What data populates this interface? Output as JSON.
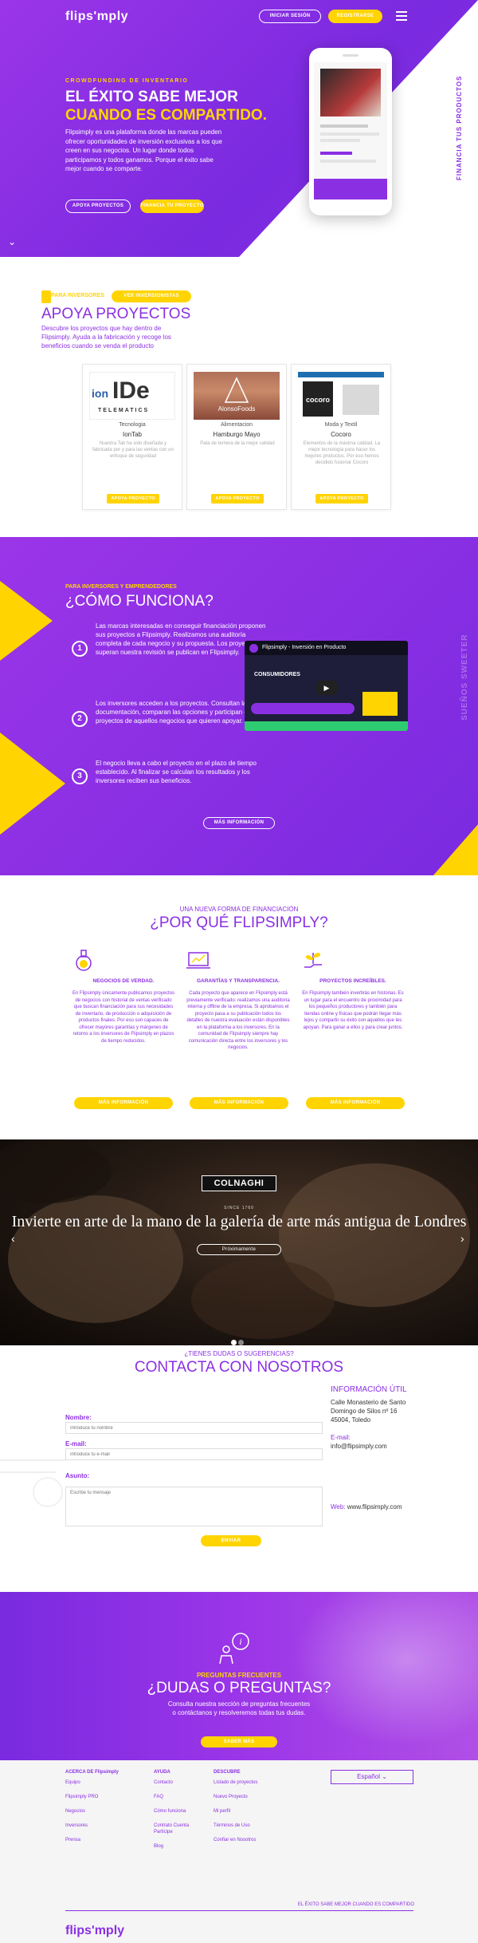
{
  "header": {
    "logo": "flipsʹmply",
    "login": "INICIAR SESIÓN",
    "register": "REGISTRARSE"
  },
  "hero": {
    "tag": "CROWDFUNDING DE INVENTARIO",
    "title1": "EL ÉXITO SABE MEJOR",
    "title2": "CUANDO ES COMPARTIDO.",
    "text": "Flipsimply es una plataforma donde las marcas pueden ofrecer oportunidades de inversión exclusivas a los que creen en sus negocios. Un lugar donde todos participamos y todos ganamos. Porque el éxito sabe mejor cuando se comparte.",
    "btn_apoya": "APOYA PROYECTOS",
    "btn_financia": "FINANCIA TU PROYECTO",
    "vertical": "FINANCIA TUS PRODUCTOS"
  },
  "apoya": {
    "tag": "PARA INVERSORES",
    "tag_btn": "VER INVERSIONISTAS",
    "title": "APOYA PROYECTOS",
    "desc": "Descubre los proyectos que hay dentro de Flipsimply. Ayuda a la fabricación y recoge los beneficios cuando se venda el producto",
    "cards": [
      {
        "category": "Tecnologia",
        "name": "IonTab",
        "logo1": "ion",
        "logo2": "IDe",
        "logo3": "TELEMATICS",
        "desc": "Nuestra Tab ha sido diseñada y fabricada por y para las ventas con un enfoque de seguridad",
        "button": "APOYA PROYECTO"
      },
      {
        "category": "Alimentacion",
        "name": "Hamburgo Mayo",
        "logo1": "AlonsoFoods",
        "desc": "Pata de ternera de la mejor calidad",
        "button": "APOYA PROYECTO"
      },
      {
        "category": "Moda y Textil",
        "name": "Cocoro",
        "logo1": "cocoro",
        "desc": "Elementos de la máxima calidad. La mejor tecnología para hacer los mejores productos. Por eso hemos decidido fusionar Cocoro",
        "button": "APOYA PROYECTO"
      }
    ]
  },
  "como": {
    "tag": "PARA INVERSORES Y EMPRENDEDORES",
    "title": "¿CÓMO FUNCIONA?",
    "steps": [
      {
        "num": "1",
        "text": "Las marcas interesadas en conseguir financiación proponen sus proyectos a Flipsimply. Realizamos una auditoría completa de cada negocio y su propuesta. Los proyectos que superan nuestra revisión se publican en Flipsimply."
      },
      {
        "num": "2",
        "text": "Los inversores acceden a los proyectos. Consultan la documentación, comparan las opciones y participan en los proyectos de aquellos negocios que quieren apoyar."
      },
      {
        "num": "3",
        "text": "El negocio lleva a cabo el proyecto en el plazo de tiempo establecido. Al finalizar se calculan los resultados y los inversores reciben sus beneficios."
      }
    ],
    "video_title": "Flipsimply - Inversión en Producto",
    "video_sub": "CONSUMIDORES",
    "vertical": "SUEÑOS SWEETER",
    "btn": "MÁS INFORMACIÓN"
  },
  "porque": {
    "tag": "UNA NUEVA FORMA DE FINANCIACIÓN",
    "title": "¿POR QUÉ FLIPSIMPLY?",
    "cols": [
      {
        "title": "NEGOCIOS DE VERDAD.",
        "text": "En Flipsimply únicamente publicamos proyectos de negocios con historial de ventas verificado que buscan financiación para sus necesidades de inventario, de producción o adquisición de productos finales. Por eso son capaces de ofrecer mayores garantías y márgenes de retorno a los inversores de Flipsimply en plazos de tiempo reducidos.",
        "button": "MÁS INFORMACIÓN"
      },
      {
        "title": "GARANTÍAS Y TRANSPARENCIA.",
        "text": "Cada proyecto que aparece en Flipsimply está previamente verificado: realizamos una auditoría interna y offline de la empresa. Si aprobamos el proyecto pasa a su publicación todos los detalles de nuestra evaluación están disponibles en la plataforma a los inversores. En la comunidad de Flipsimply siempre hay comunicación directa entre los inversores y los negocios.",
        "button": "MÁS INFORMACIÓN"
      },
      {
        "title": "PROYECTOS INCREÍBLES.",
        "text": "En Flipsimply también invertirás en historias. Es un lugar para el encuentro de proximidad para los pequeños productores y también para tiendas online y físicas que podrán llegar más lejos y compartir su éxito con aquellos que les apoyan. Para ganar a ellos y para crear juntos.",
        "button": "MÁS INFORMACIÓN"
      }
    ]
  },
  "slider": {
    "logo": "COLNAGHI",
    "since": "SINCE 1760",
    "title": "Invierte en arte de la mano de la galería de arte más antigua de Londres",
    "button": "Próximamente"
  },
  "contact": {
    "sub": "¿TIENES DUDAS O SUGERENCIAS?",
    "title": "CONTACTA CON NOSOTROS",
    "name_label": "Nombre:",
    "name_ph": "Introduce tu nombre",
    "email_label": "E-mail:",
    "email_ph": "Introduce tu e-mail",
    "subject_label": "Asunto:",
    "subject_ph": "Escribe tu mensaje",
    "button": "ENVIAR",
    "info_title": "INFORMACIÓN ÚTIL",
    "address": "Calle Monasterio de Santo Domingo de Silos nº 16 45004, Toledo",
    "email_key": "E-mail:",
    "email_val": "info@flipsimply.com",
    "web_key": "Web:",
    "web_val": "www.flipsimply.com"
  },
  "dudas": {
    "tag": "PREGUNTAS FRECUENTES",
    "title": "¿DUDAS O PREGUNTAS?",
    "text": "Consulta nuestra sección de preguntas frecuentes o contáctanos y resolveremos todas tus dudas.",
    "button": "SABER MÁS"
  },
  "footer": {
    "col1": {
      "head": "ACERCA DE Flipsimply",
      "items": [
        "Equipo",
        "Flipsimply PRO",
        "Negocios",
        "Inversores",
        "Prensa"
      ]
    },
    "col2": {
      "head": "AYUDA",
      "items": [
        "Contacto",
        "FAQ",
        "Cómo funciona",
        "Contrato Cuenta Partícipe",
        "Blog"
      ]
    },
    "col3": {
      "head": "DESCUBRE",
      "items": [
        "Listado de proyectos",
        "Nuevo Proyecto",
        "Mi perfil",
        "Términos de Uso",
        "Confiar en Nosotros"
      ]
    },
    "lang": "Español",
    "slogan": "EL ÉXITO SABE MEJOR CUANDO ES COMPARTIDO",
    "logo": "flipsʹmply"
  },
  "colors": {
    "purple": "#8b2fe3",
    "yellow": "#ffd400"
  }
}
